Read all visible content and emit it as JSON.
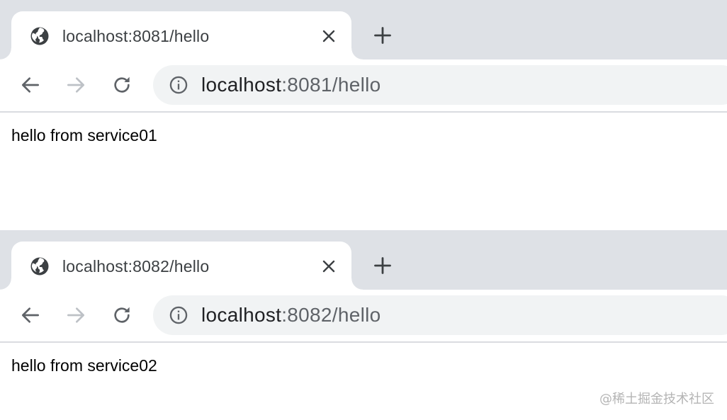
{
  "browsers": [
    {
      "tab": {
        "title": "localhost:8081/hello"
      },
      "address_bar": {
        "host": "localhost",
        "rest": ":8081/hello"
      },
      "page": {
        "text": "hello from service01"
      }
    },
    {
      "tab": {
        "title": "localhost:8082/hello"
      },
      "address_bar": {
        "host": "localhost",
        "rest": ":8082/hello"
      },
      "page": {
        "text": "hello from service02"
      }
    }
  ],
  "icons": {
    "tab_favicon": "globe-icon",
    "tab_close": "close-icon",
    "new_tab": "plus-icon",
    "back": "arrow-left-icon",
    "forward": "arrow-right-icon",
    "reload": "reload-icon",
    "site_info": "info-icon"
  },
  "colors": {
    "tabstrip_bg": "#dee1e6",
    "omnibox_bg": "#f1f3f4",
    "icon": "#5f6368",
    "icon_disabled": "#bdc1c6"
  },
  "watermark": "@稀土掘金技术社区"
}
